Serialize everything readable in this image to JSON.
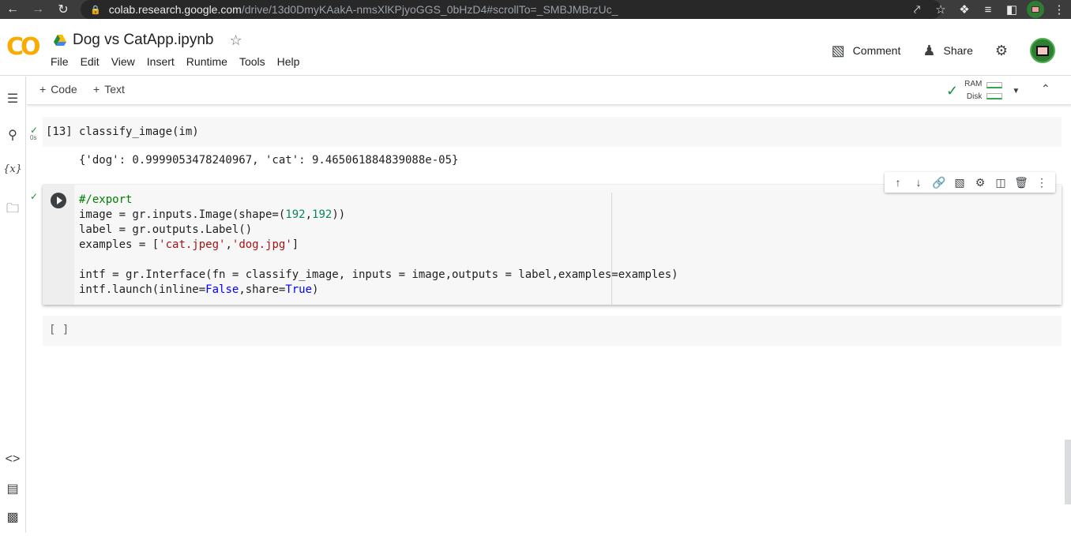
{
  "browser": {
    "url_host": "colab.research.google.com",
    "url_path": "/drive/13d0DmyKAakA-nmsXlKPjyoGGS_0bHzD4#scrollTo=_SMBJMBrzUc_"
  },
  "header": {
    "logo": "CO",
    "notebook_title": "Dog vs CatApp.ipynb",
    "menu": [
      "File",
      "Edit",
      "View",
      "Insert",
      "Runtime",
      "Tools",
      "Help"
    ],
    "comment_label": "Comment",
    "share_label": "Share"
  },
  "toolbar": {
    "add_code_label": "Code",
    "add_text_label": "Text",
    "ram_label": "RAM",
    "disk_label": "Disk"
  },
  "cells": [
    {
      "exec_count": "[13]",
      "exec_time": "0s",
      "code": "classify_image(im)",
      "output": "{'dog': 0.9999053478240967, 'cat': 9.465061884839088e-05}"
    },
    {
      "code_lines": [
        "#/export",
        "image = gr.inputs.Image(shape=(192,192))",
        "label = gr.outputs.Label()",
        "examples = ['cat.jpeg','dog.jpg']",
        "",
        "intf = gr.Interface(fn = classify_image, inputs = image,outputs = label,examples=examples)",
        "intf.launch(inline=False,share=True)"
      ]
    },
    {
      "exec_count": "[ ]"
    }
  ],
  "colors": {
    "logo_orange": "#e8710a",
    "logo_yellow": "#f9ab00",
    "success_green": "#1e8e3e"
  }
}
